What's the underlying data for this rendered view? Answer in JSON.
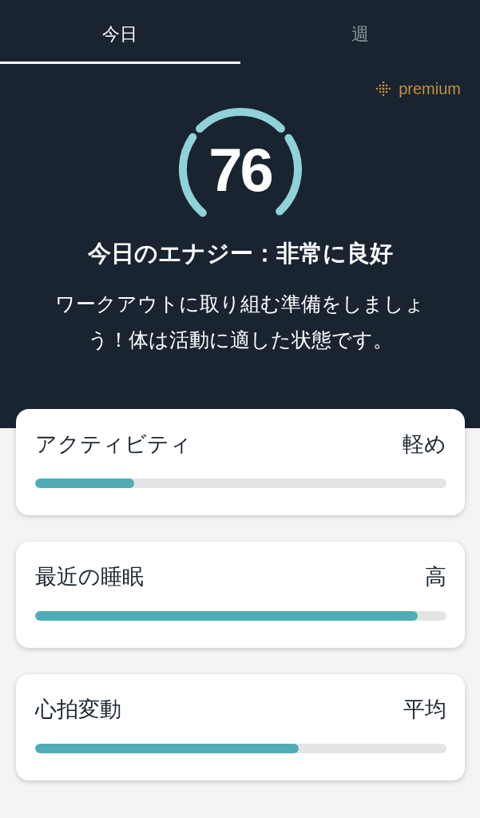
{
  "tabs": [
    {
      "label": "今日",
      "selected": true
    },
    {
      "label": "週",
      "selected": false
    }
  ],
  "premium_badge": {
    "label": "premium"
  },
  "energy": {
    "score": "76",
    "title": "今日のエナジー：非常に良好",
    "message": "ワークアウトに取り組む準備をしましょう！体は活動に適した状態です。"
  },
  "metrics": [
    {
      "name": "アクティビティ",
      "reading": "軽め",
      "level": 0.24
    },
    {
      "name": "最近の睡眠",
      "reading": "高",
      "level": 0.93
    },
    {
      "name": "心拍変動",
      "reading": "平均",
      "level": 0.64
    }
  ]
}
